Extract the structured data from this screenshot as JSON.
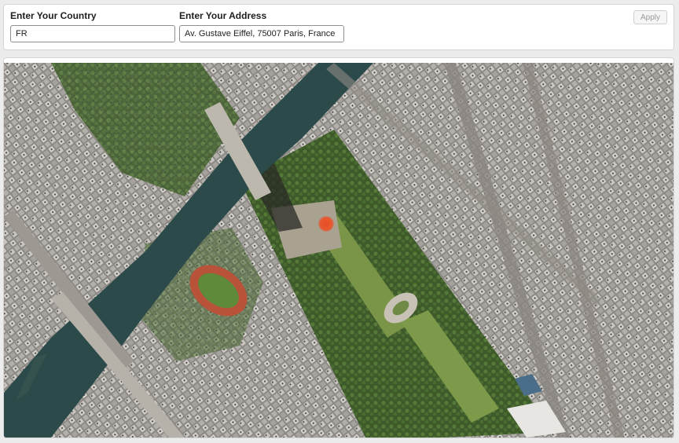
{
  "form": {
    "country": {
      "label": "Enter Your Country",
      "value": "FR"
    },
    "address": {
      "label": "Enter Your Address",
      "value": "Av. Gustave Eiffel, 75007 Paris, France"
    },
    "apply_label": "Apply"
  },
  "map": {
    "view": "satellite",
    "marker_icon": "location-pin-icon",
    "marker_color": "#e8502a",
    "water_color": "#2c4a4a",
    "park_color": "#4e6b34"
  }
}
